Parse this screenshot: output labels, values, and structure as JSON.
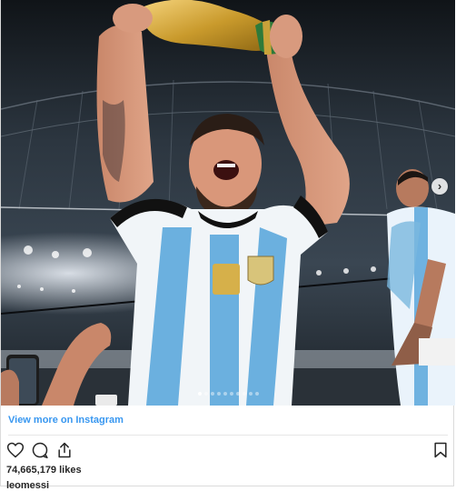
{
  "post": {
    "carousel": {
      "dot_count": 10,
      "active_dot": 0,
      "next_icon": "chevron-right-icon"
    },
    "view_more_label": "View more on Instagram",
    "actions": {
      "like_icon": "heart-icon",
      "comment_icon": "comment-icon",
      "share_icon": "share-icon",
      "save_icon": "bookmark-icon"
    },
    "likes_text": "74,665,179 likes",
    "username": "leomessi"
  },
  "colors": {
    "link": "#3897f0",
    "text": "#262626",
    "divider": "#e6e6e6"
  }
}
